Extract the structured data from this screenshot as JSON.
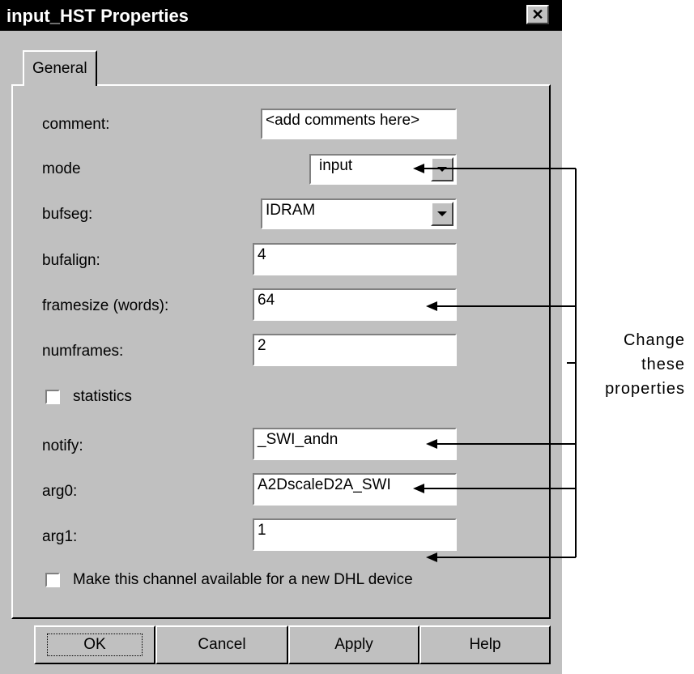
{
  "window": {
    "title": "input_HST Properties",
    "close_glyph": "✕"
  },
  "tab": {
    "label": "General"
  },
  "fields": {
    "comment": {
      "label": "comment:",
      "value": "<add comments here>"
    },
    "mode": {
      "label": "mode",
      "value": "input"
    },
    "bufseg": {
      "label": "bufseg:",
      "value": "IDRAM"
    },
    "bufalign": {
      "label": "bufalign:",
      "value": "4"
    },
    "framesize": {
      "label": "framesize (words):",
      "value": "64"
    },
    "numframes": {
      "label": "numframes:",
      "value": "2"
    },
    "statistics": {
      "label": "statistics",
      "checked": false
    },
    "notify": {
      "label": "notify:",
      "value": "_SWI_andn"
    },
    "arg0": {
      "label": "arg0:",
      "value": "A2DscaleD2A_SWI"
    },
    "arg1": {
      "label": "arg1:",
      "value": "1"
    },
    "dhl": {
      "label": "Make this channel available for a new DHL device",
      "checked": false
    }
  },
  "buttons": {
    "ok": "OK",
    "cancel": "Cancel",
    "apply": "Apply",
    "help": "Help"
  },
  "annotation": {
    "line1": "Change",
    "line2": "these",
    "line3": "properties"
  },
  "colors": {
    "dialog_bg": "#c0c0c0",
    "titlebar_bg": "#000000",
    "field_bg": "#ffffff"
  },
  "icons": {
    "close": "close-icon",
    "dropdown": "chevron-down-icon",
    "arrow": "arrow-left-icon"
  }
}
